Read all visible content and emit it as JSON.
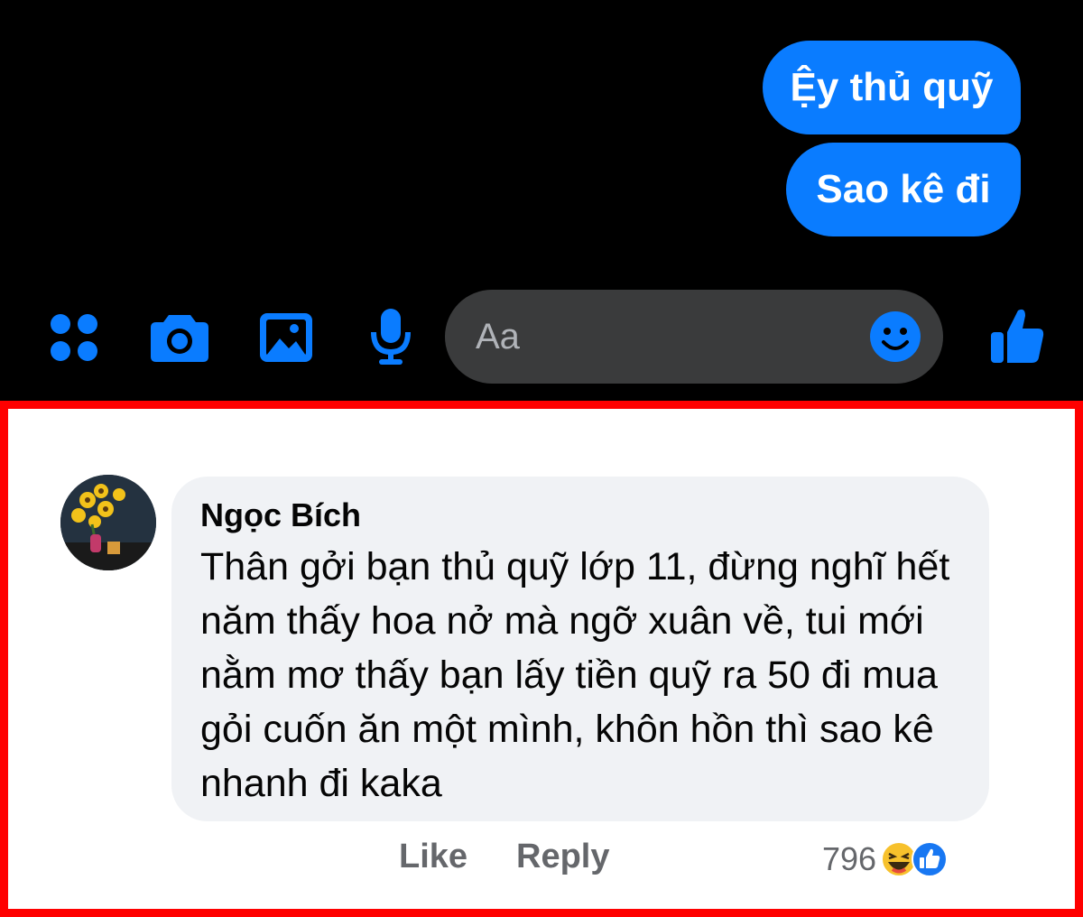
{
  "messenger": {
    "messages": [
      {
        "text": "Ệy thủ quỹ"
      },
      {
        "text": "Sao kê đi"
      }
    ],
    "composer": {
      "placeholder": "Aa"
    },
    "accent_color": "#0a7cff",
    "toolbar_icons": [
      "apps-icon",
      "camera-icon",
      "image-icon",
      "microphone-icon",
      "emoji-icon",
      "thumbs-up-icon"
    ]
  },
  "comment": {
    "author": "Ngọc Bích",
    "text": "Thân gởi bạn thủ quỹ lớp 11, đừng nghĩ hết năm thấy hoa nở mà ngỡ xuân về, tui mới nằm mơ thấy bạn lấy tiền quỹ ra 50 đi mua gỏi cuốn ăn một mình, khôn hồn thì sao kê nhanh đi kaka",
    "actions": {
      "like": "Like",
      "reply": "Reply"
    },
    "reaction_count": "796",
    "reaction_icons": [
      "haha-icon",
      "like-reaction-icon"
    ],
    "highlight_color": "#ff0000"
  }
}
